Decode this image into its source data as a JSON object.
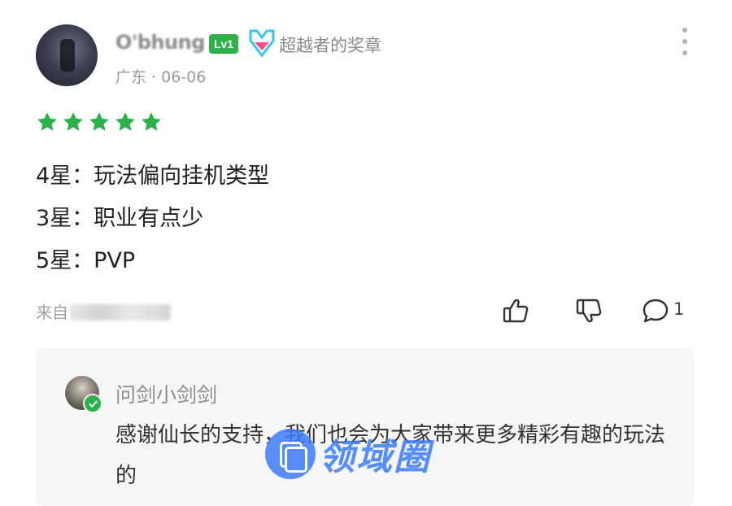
{
  "review": {
    "username": "O'bhung",
    "level": "Lv1",
    "medal_label": "超越者的奖章",
    "meta": "广东 · 06-06",
    "rating": 5,
    "lines": [
      "4星：玩法偏向挂机类型",
      "3星：职业有点少",
      "5星：PVP"
    ],
    "source_prefix": "来自",
    "comment_count": "1"
  },
  "reply": {
    "author": "问剑小剑剑",
    "text": "感谢仙长的支持，我们也会为大家带来更多精彩有趣的玩法的"
  },
  "watermark": {
    "text": "领域圈"
  },
  "colors": {
    "star": "#2bb04a",
    "level_badge": "#2bb04a",
    "watermark": "#3d7dfc",
    "reply_bg": "#f5f6f7"
  },
  "icons": [
    "more-icon",
    "star-icon",
    "thumbs-up-icon",
    "thumbs-down-icon",
    "comment-icon",
    "verified-icon"
  ]
}
